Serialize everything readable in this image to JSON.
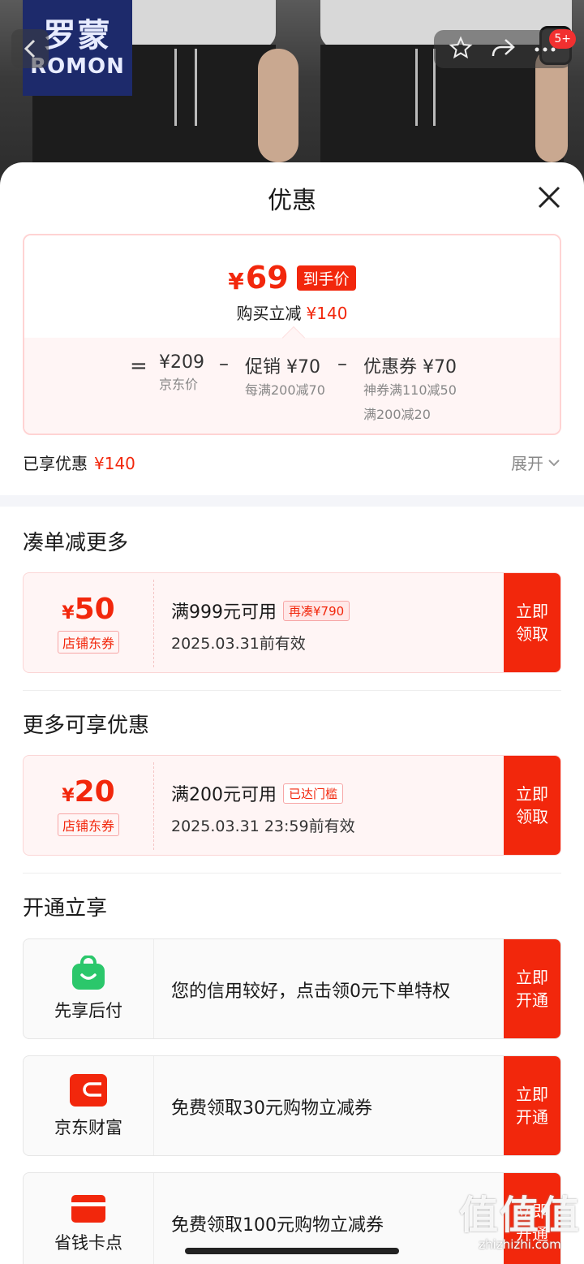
{
  "product": {
    "brand_cn": "罗蒙",
    "brand_en": "ROMON",
    "notification_count": "5+"
  },
  "sheet": {
    "title": "优惠",
    "final_price": {
      "symbol": "¥",
      "value": "69",
      "tag": "到手价",
      "sub_label": "购买立减",
      "sub_value": "¥140"
    },
    "breakdown": {
      "equals": "=",
      "base": {
        "main": "¥209",
        "note": "京东价"
      },
      "minus1": "–",
      "promo": {
        "main": "促销 ¥70",
        "note": "每满200减70"
      },
      "minus2": "–",
      "coupon": {
        "main": "优惠券 ¥70",
        "note1": "神券满110减50",
        "note2": "满200减20"
      }
    },
    "enjoyed_label": "已享优惠",
    "enjoyed_value": "¥140",
    "expand_label": "展开"
  },
  "sections": {
    "more_order": "凑单减更多",
    "more_discount": "更多可享优惠",
    "open_enjoy": "开通立享"
  },
  "coupons": [
    {
      "symbol": "¥",
      "amount": "50",
      "type": "店铺东券",
      "condition": "满999元可用",
      "badge": "再凑¥790",
      "validity": "2025.03.31前有效",
      "btn1": "立即",
      "btn2": "领取"
    },
    {
      "symbol": "¥",
      "amount": "20",
      "type": "店铺东券",
      "condition": "满200元可用",
      "badge": "已达门槛",
      "validity": "2025.03.31 23:59前有效",
      "btn1": "立即",
      "btn2": "领取"
    }
  ],
  "services": [
    {
      "name": "先享后付",
      "icon": "shopping-bag-icon",
      "text": "您的信用较好，点击领0元下单特权",
      "btn1": "立即",
      "btn2": "开通",
      "color": "#2bc76b"
    },
    {
      "name": "京东财富",
      "icon": "wallet-icon",
      "text": "免费领取30元购物立减券",
      "btn1": "立即",
      "btn2": "开通",
      "color": "#f2270c"
    },
    {
      "name": "省钱卡点",
      "icon": "card-icon",
      "text": "免费领取100元购物立减券",
      "btn1": "立即",
      "btn2": "开通",
      "color": "#f2270c"
    }
  ],
  "watermark": {
    "big": "值值值",
    "small": "zhizhizhi.com"
  },
  "colors": {
    "accent": "#f2270c",
    "light_pink": "#fff5f5"
  }
}
